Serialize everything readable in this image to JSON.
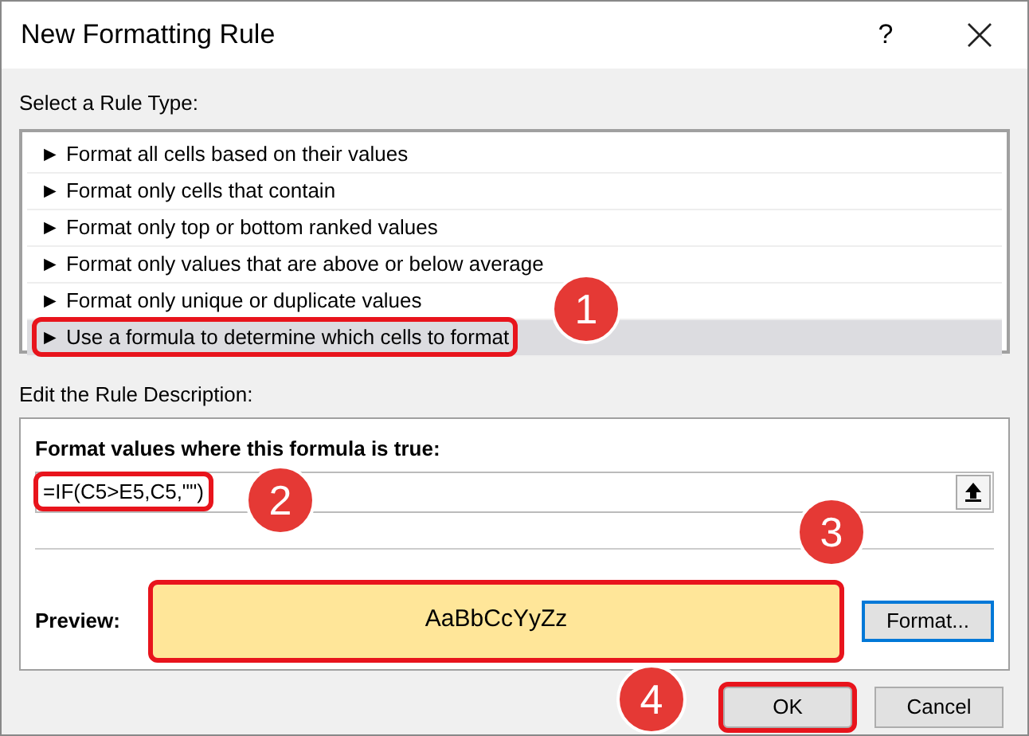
{
  "window": {
    "title": "New Formatting Rule",
    "help": "?"
  },
  "rule_type": {
    "label": "Select a Rule Type:",
    "items": [
      {
        "text": "► Format all cells based on their values",
        "selected": false,
        "highlighted": false
      },
      {
        "text": "► Format only cells that contain",
        "selected": false,
        "highlighted": false
      },
      {
        "text": "► Format only top or bottom ranked values",
        "selected": false,
        "highlighted": false
      },
      {
        "text": "► Format only values that are above or below average",
        "selected": false,
        "highlighted": false
      },
      {
        "text": "► Format only unique or duplicate values",
        "selected": false,
        "highlighted": false
      },
      {
        "text": "► Use a formula to determine which cells to format",
        "selected": true,
        "highlighted": true
      }
    ]
  },
  "description": {
    "label": "Edit the Rule Description:",
    "formula_label": "Format values where this formula is true:",
    "formula": {
      "value": "=IF(C5>E5,C5,\"\")",
      "highlighted": true
    },
    "preview_label": "Preview:",
    "preview": {
      "text": "AaBbCcYyZz",
      "color": "#ffe699",
      "highlighted": true
    },
    "format_button": "Format..."
  },
  "buttons": [
    {
      "label": "OK",
      "highlighted": true
    },
    {
      "label": "Cancel",
      "highlighted": false
    }
  ],
  "annotations": [
    "1",
    "2",
    "3",
    "4"
  ]
}
